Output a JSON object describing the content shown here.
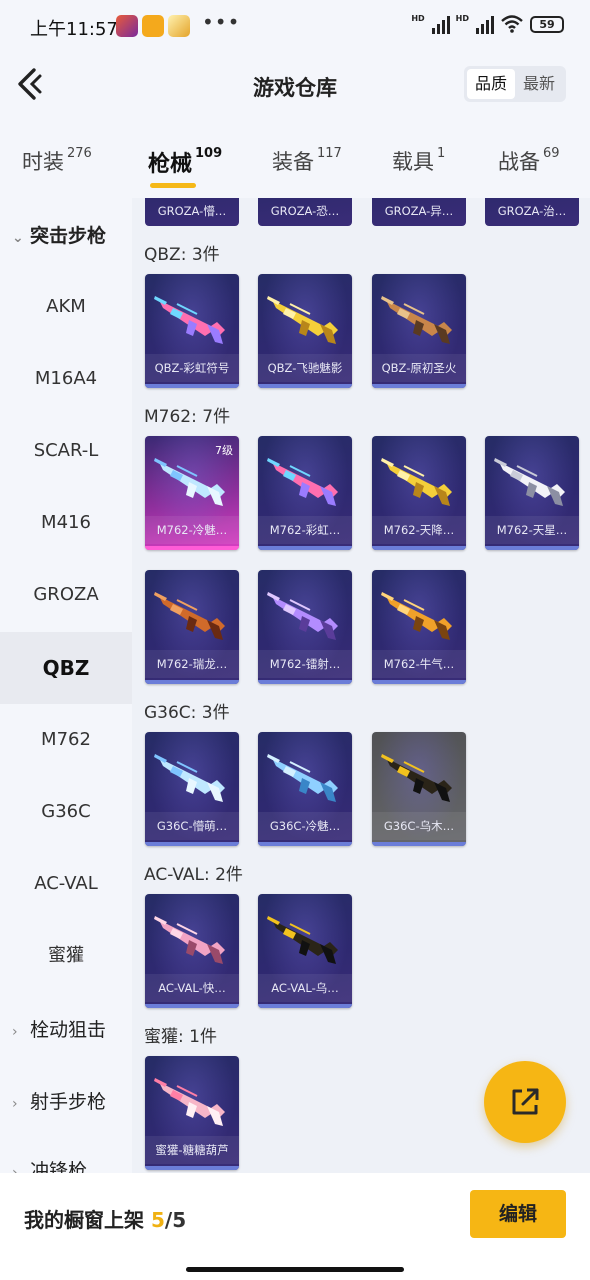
{
  "status": {
    "time": "上午11:57",
    "dots": "•••",
    "battery": "59",
    "hd1": "HD",
    "hd2": "HD"
  },
  "header": {
    "title": "游戏仓库",
    "sort_options": [
      "品质",
      "最新"
    ],
    "sort_selected": "品质"
  },
  "tabs": [
    {
      "label": "时装",
      "count": "276"
    },
    {
      "label": "枪械",
      "count": "109"
    },
    {
      "label": "装备",
      "count": "117"
    },
    {
      "label": "载具",
      "count": "1"
    },
    {
      "label": "战备",
      "count": "69"
    }
  ],
  "active_tab": "枪械",
  "sidebar": {
    "group_open": "突击步枪",
    "items": [
      "AKM",
      "M16A4",
      "SCAR-L",
      "M416",
      "GROZA",
      "QBZ",
      "M762",
      "G36C",
      "AC-VAL",
      "蜜獾"
    ],
    "active_item": "QBZ",
    "collapsed_groups": [
      "栓动狙击",
      "射手步枪",
      "冲锋枪"
    ]
  },
  "content": {
    "top_partial_cards": [
      "GROZA-懵…",
      "GROZA-恐…",
      "GROZA-异…",
      "GROZA-治…"
    ],
    "sections": [
      {
        "title": "QBZ: 3件",
        "cards": [
          {
            "name": "QBZ-彩虹符号",
            "palette": "rainbow"
          },
          {
            "name": "QBZ-飞驰魅影",
            "palette": "gold"
          },
          {
            "name": "QBZ-原初圣火",
            "palette": "bronze"
          }
        ]
      },
      {
        "title": "M762: 7件",
        "cards": [
          {
            "name": "M762-冷魅…",
            "palette": "ice",
            "level": "7级",
            "rarity": "pink"
          },
          {
            "name": "M762-彩虹…",
            "palette": "rainbow"
          },
          {
            "name": "M762-天降…",
            "palette": "gold"
          },
          {
            "name": "M762-天星…",
            "palette": "white"
          },
          {
            "name": "M762-瑞龙…",
            "palette": "copper"
          },
          {
            "name": "M762-镭射…",
            "palette": "violet"
          },
          {
            "name": "M762-牛气…",
            "palette": "amber"
          }
        ]
      },
      {
        "title": "G36C: 3件",
        "cards": [
          {
            "name": "G36C-懵萌…",
            "palette": "ice"
          },
          {
            "name": "G36C-冷魅…",
            "palette": "sky"
          },
          {
            "name": "G36C-乌木…",
            "palette": "blackgold",
            "rarity": "grey"
          }
        ]
      },
      {
        "title": "AC-VAL: 2件",
        "cards": [
          {
            "name": "AC-VAL-快…",
            "palette": "rose"
          },
          {
            "name": "AC-VAL-乌…",
            "palette": "blackgold"
          }
        ]
      },
      {
        "title": "蜜獾: 1件",
        "cards": [
          {
            "name": "蜜獾-糖糖葫芦",
            "palette": "candy"
          }
        ]
      }
    ]
  },
  "bottom": {
    "label": "我的橱窗上架",
    "count": "5",
    "total": "/5",
    "edit_label": "编辑"
  },
  "colors": {
    "accent": "#f6b614",
    "card_bg": "#2e2970",
    "rare_pink": "#d93fc3"
  }
}
